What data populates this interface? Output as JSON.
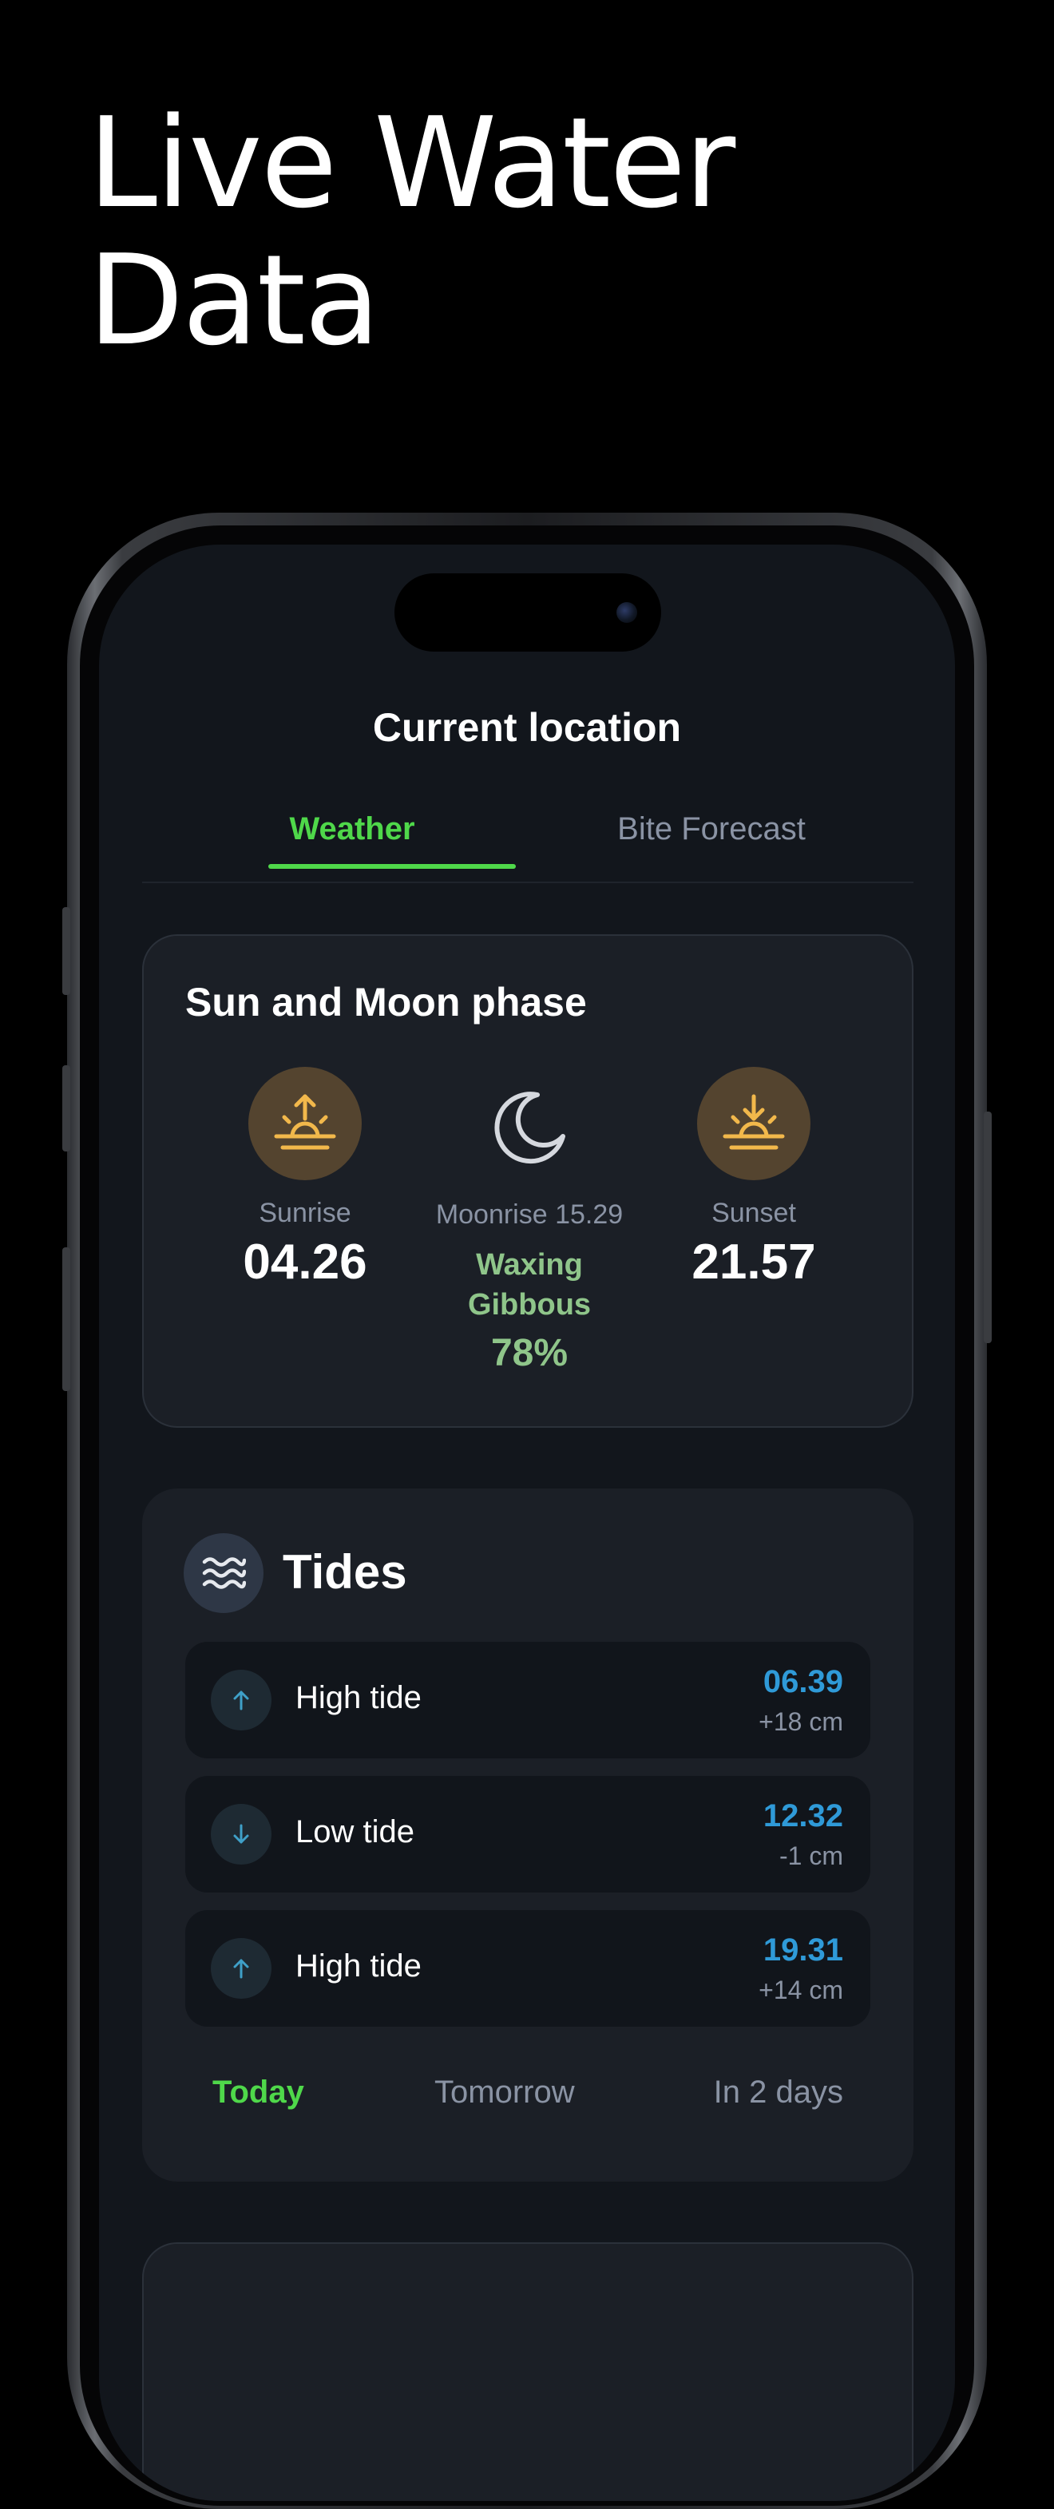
{
  "headline": {
    "line1": "Live Water",
    "line2": "Data"
  },
  "screen": {
    "title": "Current location",
    "tabs": [
      {
        "label": "Weather",
        "active": true
      },
      {
        "label": "Bite Forecast",
        "active": false
      }
    ]
  },
  "sun_moon": {
    "title": "Sun and Moon phase",
    "sunrise": {
      "label": "Sunrise",
      "time": "04.26",
      "icon": "sunrise-icon"
    },
    "moon": {
      "moonrise": "Moonrise 15.29",
      "phase_line1": "Waxing",
      "phase_line2": "Gibbous",
      "illumination": "78%",
      "icon": "moon-icon"
    },
    "sunset": {
      "label": "Sunset",
      "time": "21.57",
      "icon": "sunset-icon"
    }
  },
  "tides": {
    "title": "Tides",
    "icon": "waves-icon",
    "rows": [
      {
        "direction": "up",
        "label": "High tide",
        "time": "06.39",
        "diff": "+18 cm"
      },
      {
        "direction": "down",
        "label": "Low tide",
        "time": "12.32",
        "diff": "-1 cm"
      },
      {
        "direction": "up",
        "label": "High tide",
        "time": "19.31",
        "diff": "+14 cm"
      }
    ],
    "day_tabs": [
      {
        "label": "Today",
        "active": true
      },
      {
        "label": "Tomorrow",
        "active": false
      },
      {
        "label": "In 2 days",
        "active": false
      }
    ]
  },
  "colors": {
    "accent_green": "#4fd84a",
    "tide_blue": "#2f9ad8",
    "sun_gold": "#f2b84b",
    "phase_green": "#8fc58a"
  }
}
